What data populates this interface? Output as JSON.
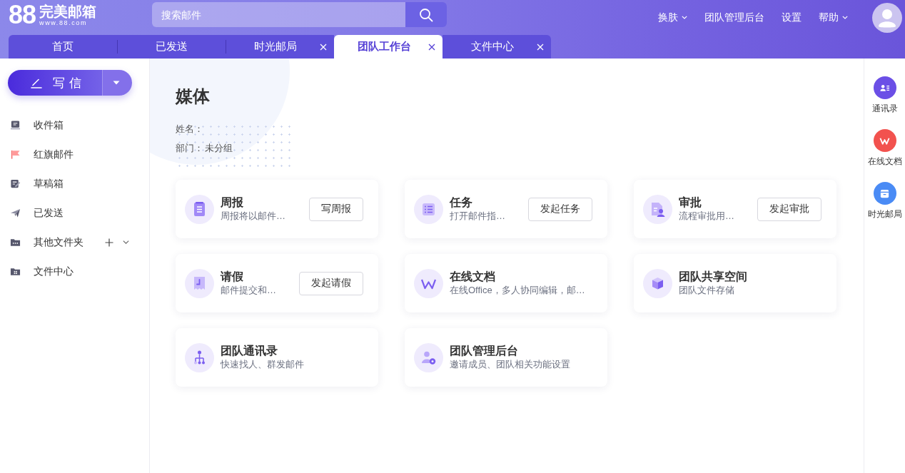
{
  "header": {
    "logo": {
      "mark": "88",
      "name": "完美邮箱",
      "domain": "www.88.com"
    },
    "search": {
      "placeholder": "搜索邮件"
    },
    "nav": [
      {
        "label": "换肤",
        "dropdown": true
      },
      {
        "label": "团队管理后台",
        "dropdown": false
      },
      {
        "label": "设置",
        "dropdown": false
      },
      {
        "label": "帮助",
        "dropdown": true
      }
    ]
  },
  "tabs": [
    {
      "label": "首页",
      "selected": false,
      "closable": false
    },
    {
      "label": "已发送",
      "selected": false,
      "closable": false
    },
    {
      "label": "时光邮局",
      "selected": false,
      "closable": true
    },
    {
      "label": "团队工作台",
      "selected": true,
      "closable": true
    },
    {
      "label": "文件中心",
      "selected": false,
      "closable": true
    }
  ],
  "sidebar": {
    "compose": {
      "label": "写信"
    },
    "folders": [
      {
        "label": "收件箱",
        "kind": "folder"
      },
      {
        "label": "红旗邮件",
        "kind": "folder"
      },
      {
        "label": "草稿箱",
        "kind": "folder"
      },
      {
        "label": "已发送",
        "kind": "folder"
      },
      {
        "label": "其他文件夹",
        "kind": "group"
      },
      {
        "label": "文件中心",
        "kind": "folder"
      }
    ]
  },
  "profile": {
    "title": "媒体",
    "name_label": "姓名：",
    "dept_label": "部门：",
    "dept": "未分组"
  },
  "cards": [
    {
      "title": "周报",
      "desc": "周报将以邮件…",
      "button": "写周报"
    },
    {
      "title": "任务",
      "desc": "打开邮件指…",
      "button": "发起任务"
    },
    {
      "title": "审批",
      "desc": "流程审批用…",
      "button": "发起审批"
    },
    {
      "title": "请假",
      "desc": "邮件提交和…",
      "button": "发起请假"
    },
    {
      "title": "在线文档",
      "desc": "在线Office，多人协同编辑，邮…"
    },
    {
      "title": "团队共享空间",
      "desc": "团队文件存储"
    },
    {
      "title": "团队通讯录",
      "desc": "快速找人、群发邮件"
    },
    {
      "title": "团队管理后台",
      "desc": "邀请成员、团队相关功能设置"
    }
  ],
  "right_rail": [
    {
      "label": "通讯录",
      "color": "#6b4fe6"
    },
    {
      "label": "在线文档",
      "color": "#f2524e"
    },
    {
      "label": "时光邮局",
      "color": "#4a8bf5"
    }
  ]
}
